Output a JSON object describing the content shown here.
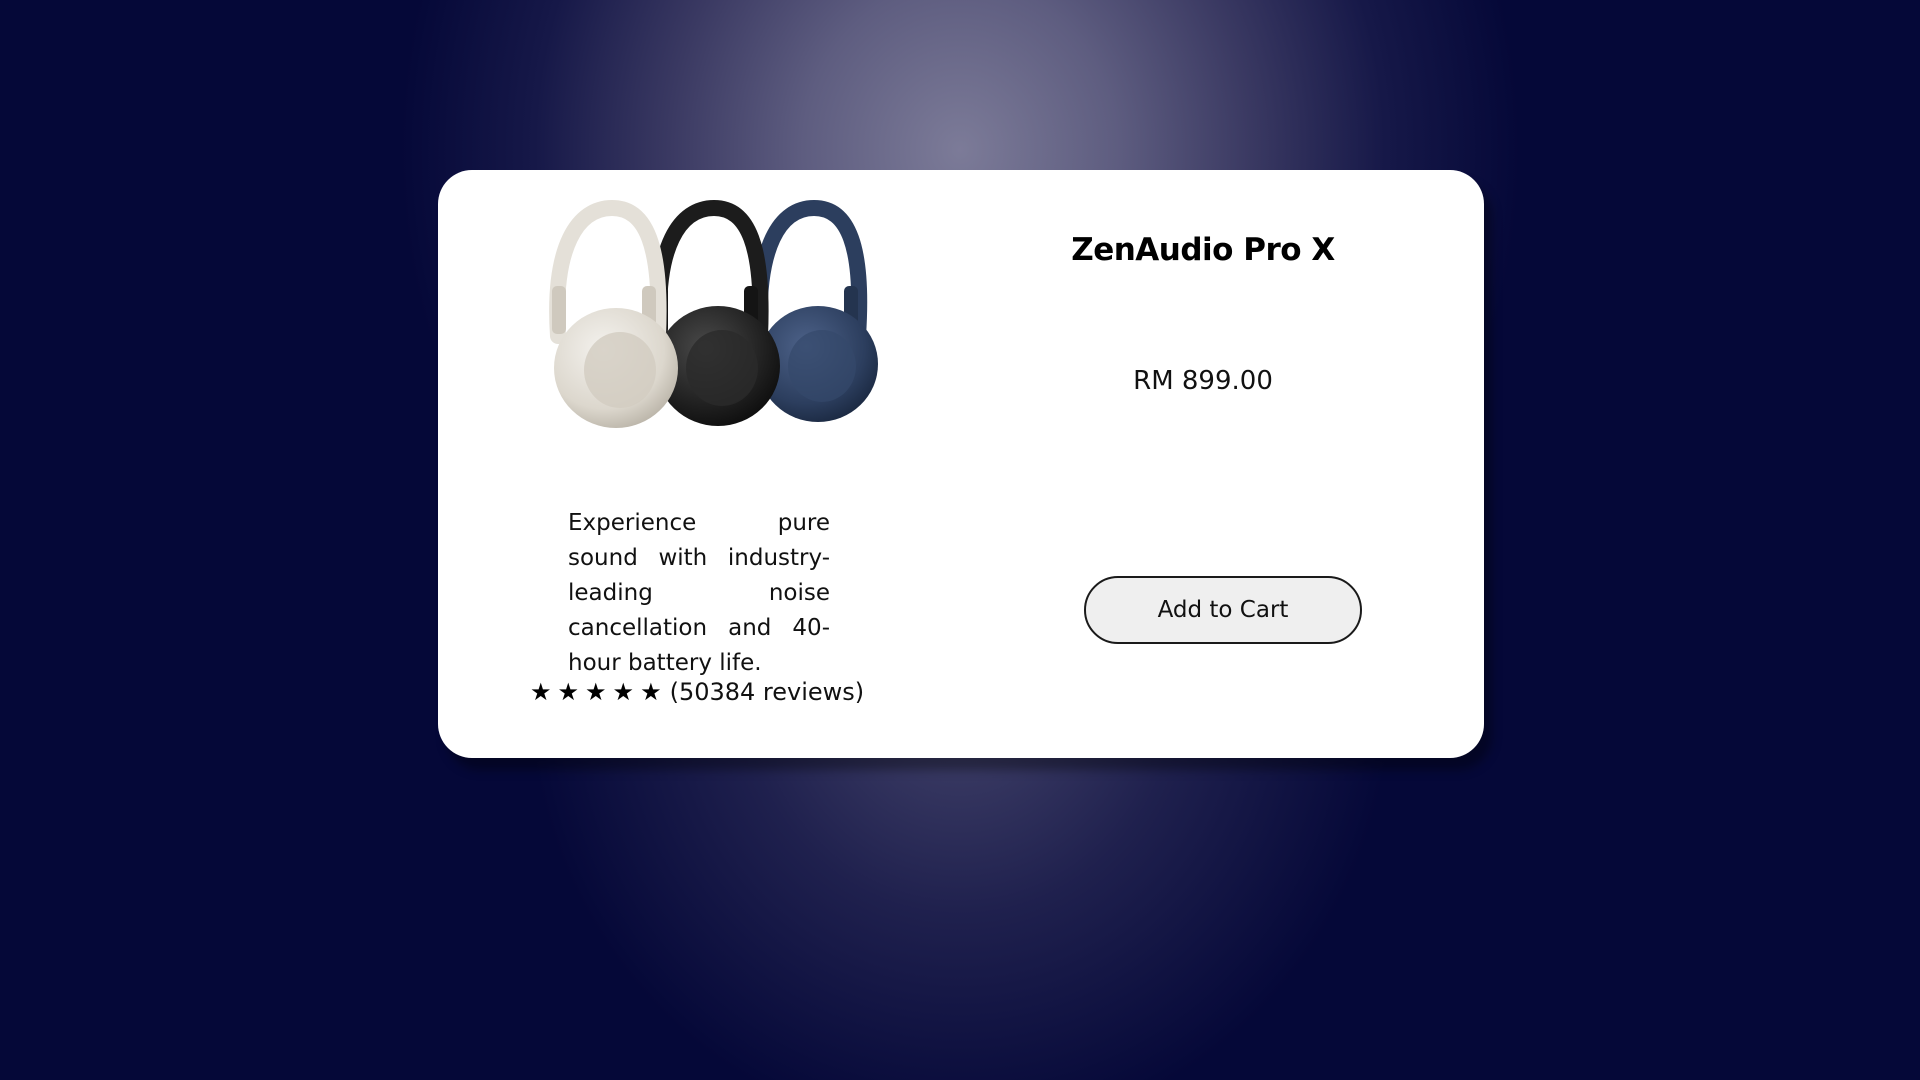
{
  "product": {
    "name": "ZenAudio Pro X",
    "price": "RM 899.00",
    "description": "Experience pure sound with industry-leading noise cancellation and 40-hour battery life.",
    "rating": {
      "stars": [
        "★",
        "★",
        "★",
        "★",
        "★"
      ],
      "value": 5,
      "max": 5,
      "reviews_text": "(50384 reviews)"
    },
    "image_icon": "headphones-product-image",
    "variant_colors": [
      "#e4e0d8",
      "#1c1c1c",
      "#2c3e5e"
    ]
  },
  "actions": {
    "add_to_cart_label": "Add to Cart"
  },
  "colors": {
    "background_dark": "#050838",
    "card": "#ffffff",
    "button_bg": "#efefef"
  }
}
